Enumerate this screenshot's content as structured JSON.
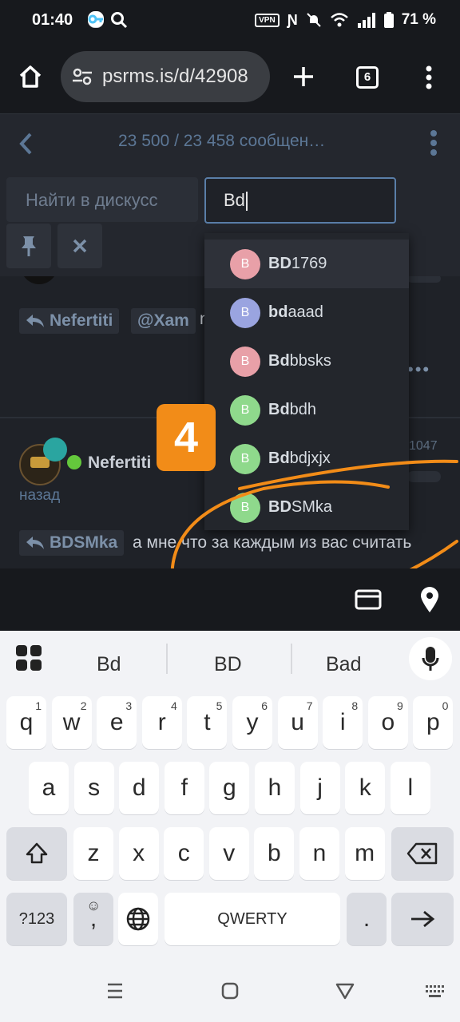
{
  "status_bar": {
    "time": "01:40",
    "vpn": "VPN",
    "battery": "71 %",
    "icons": [
      "key-icon",
      "search-icon",
      "vpn-icon",
      "nfc-icon",
      "mute-icon",
      "wifi-icon",
      "signal-icon",
      "battery-icon"
    ]
  },
  "browser": {
    "url": "psrms.is/d/42908",
    "tab_count": "6",
    "icons": [
      "home-icon",
      "site-settings-icon",
      "new-tab-icon",
      "tab-switcher-icon",
      "menu-icon"
    ]
  },
  "discussion": {
    "counter": "23 500 / 23 458 сообщен…"
  },
  "search": {
    "find_placeholder": "Найти в дискусс",
    "user_value": "Bd"
  },
  "suggestions": [
    {
      "initial": "B",
      "bold": "BD",
      "rest": "1769",
      "color": "#e8a0a8"
    },
    {
      "initial": "B",
      "bold": "bd",
      "rest": "aaad",
      "color": "#9aa4e0"
    },
    {
      "initial": "B",
      "bold": "Bd",
      "rest": "bbsks",
      "color": "#e8a0a8"
    },
    {
      "initial": "B",
      "bold": "Bd",
      "rest": "bdh",
      "color": "#8fd98c"
    },
    {
      "initial": "B",
      "bold": "Bd",
      "rest": "bdjxjx",
      "color": "#8fd98c"
    },
    {
      "initial": "B",
      "bold": "BD",
      "rest": "SMka",
      "color": "#8fd98c"
    }
  ],
  "chat": {
    "reply1_user": "Nefertiti",
    "reply1_mention": "@Xam",
    "reply1_extra": "n",
    "post_author": "Nefertiti",
    "post_time_suffix": "назад",
    "post_number": "1047",
    "reply2_user": "BDSMka",
    "reply2_text": "а мне что за каждым из вас считать"
  },
  "badge": "4",
  "keyboard": {
    "suggestions": [
      "Bd",
      "BD",
      "Bad"
    ],
    "row1": [
      [
        "q",
        "1"
      ],
      [
        "w",
        "2"
      ],
      [
        "e",
        "3"
      ],
      [
        "r",
        "4"
      ],
      [
        "t",
        "5"
      ],
      [
        "y",
        "6"
      ],
      [
        "u",
        "7"
      ],
      [
        "i",
        "8"
      ],
      [
        "o",
        "9"
      ],
      [
        "p",
        "0"
      ]
    ],
    "row2": [
      "a",
      "s",
      "d",
      "f",
      "g",
      "h",
      "j",
      "k",
      "l"
    ],
    "row3": [
      "z",
      "x",
      "c",
      "v",
      "b",
      "n",
      "m"
    ],
    "symbols": "?123",
    "emoji_comma": ",",
    "space": "QWERTY",
    "period": "."
  }
}
